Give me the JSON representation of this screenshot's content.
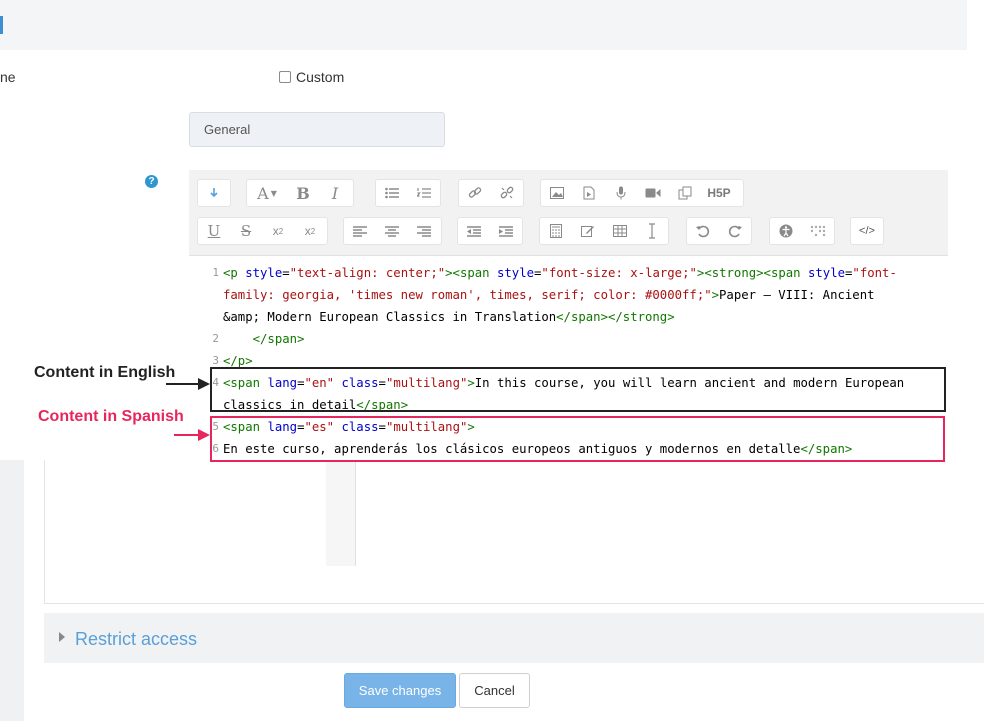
{
  "form": {
    "name_label_fragment": "ne",
    "custom_label": "Custom",
    "section_value": "General",
    "help_glyph": "?"
  },
  "toolbar": {
    "row1": [
      "collapse-icon",
      "font-size-icon",
      "bold-icon",
      "italic-icon",
      "unordered-list-icon",
      "ordered-list-icon",
      "link-icon",
      "unlink-icon",
      "image-icon",
      "media-icon",
      "record-audio-icon",
      "record-video-icon",
      "manage-files-icon",
      "h5p-icon"
    ],
    "row2": [
      "underline-icon",
      "strikethrough-icon",
      "subscript-icon",
      "superscript-icon",
      "align-left-icon",
      "align-center-icon",
      "align-right-icon",
      "outdent-icon",
      "indent-icon",
      "equation-icon",
      "edit-icon",
      "table-icon",
      "clear-formatting-icon",
      "undo-icon",
      "redo-icon",
      "accessibility-checker-icon",
      "screenreader-helper-icon",
      "html-icon"
    ],
    "h5p_text": "H5P",
    "bold_glyph": "B",
    "italic_glyph": "I",
    "underline_glyph": "U",
    "strike_glyph": "S",
    "font_glyph": "A",
    "html_glyph": "</>"
  },
  "editor": {
    "line_numbers": [
      "1",
      "2",
      "3",
      "4",
      "5",
      "6"
    ],
    "code_text": "<p style=\"text-align: center;\"><span style=\"font-size: x-large;\"><strong><span style=\"font-family: georgia, 'times new roman', times, serif; color: #0000ff;\">Paper – VIII: Ancient &amp; Modern European Classics in Translation</span></strong>\n    </span>\n</p>\n<span lang=\"en\" class=\"multilang\">In this course, you will learn ancient and modern European classics in detail</span>\n<span lang=\"es\" class=\"multilang\">\nEn este curso, aprenderás los clásicos europeos antiguos y modernos en detalle</span>"
  },
  "annotations": {
    "english": "Content in English",
    "spanish": "Content in Spanish",
    "english_color": "#222222",
    "spanish_color": "#e8265e"
  },
  "restrict": {
    "label": "Restrict access"
  },
  "actions": {
    "save_label": "Save changes",
    "cancel_label": "Cancel"
  },
  "colors": {
    "primary": "#78b4e8",
    "link": "#5a9fd8",
    "help": "#2f96d0"
  }
}
